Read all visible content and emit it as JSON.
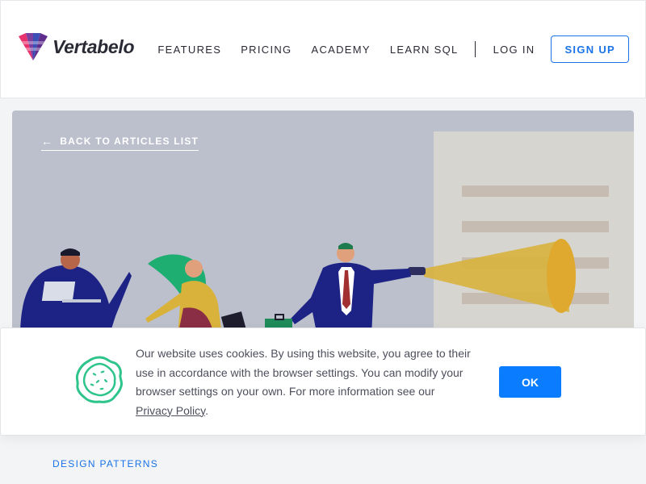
{
  "brand": {
    "name": "Vertabelo"
  },
  "nav": {
    "features": "FEATURES",
    "pricing": "PRICING",
    "academy": "ACADEMY",
    "learn_sql": "LEARN SQL",
    "login": "LOG IN",
    "signup": "SIGN UP"
  },
  "hero": {
    "back_link": "BACK TO ARTICLES LIST"
  },
  "cookie": {
    "text": "Our website uses cookies. By using this website, you agree to their use in accordance with the browser settings. You can modify your browser settings on your own. For more information see our ",
    "link": "Privacy Policy",
    "suffix": ".",
    "button": "OK"
  },
  "article": {
    "category": "DESIGN PATTERNS"
  },
  "colors": {
    "accent": "#1a73e8",
    "ok_button": "#0a7cff",
    "hero_bg": "#bcc0cc",
    "cookie_icon": "#2ec48b"
  }
}
